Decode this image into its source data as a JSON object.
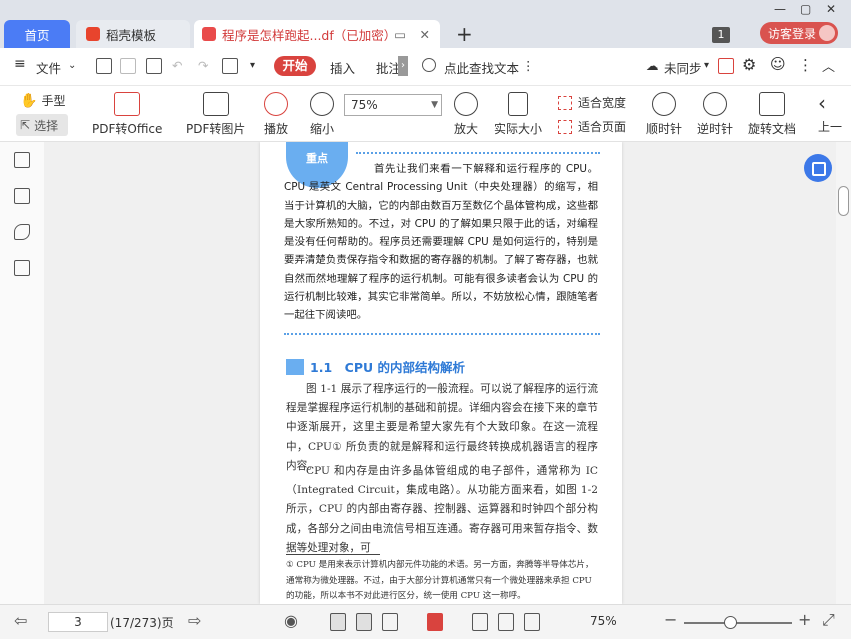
{
  "tabs": {
    "home": "首页",
    "daoke": "稻壳模板",
    "doc": "程序是怎样跑起...df（已加密）"
  },
  "window": {
    "badge": "1",
    "login": "访客登录"
  },
  "menu": {
    "file": "文件",
    "start": "开始",
    "insert": "插入",
    "annotate": "批注",
    "search_placeholder": "点此查找文本",
    "sync": "未同步"
  },
  "ribbon": {
    "hand": "手型",
    "select": "选择",
    "pdf_to_office": "PDF转Office",
    "pdf_to_image": "PDF转图片",
    "play": "播放",
    "zoom_out": "缩小",
    "zoom_value": "75%",
    "zoom_in": "放大",
    "actual_size": "实际大小",
    "fit_width": "适合宽度",
    "fit_page": "适合页面",
    "rotate_cw": "顺时针",
    "rotate_ccw": "逆时针",
    "rotate_doc": "旋转文档",
    "prev": "上一"
  },
  "document": {
    "keypoint": "重点",
    "intro": "首先让我们来看一下解释和运行程序的 CPU。CPU 是英文 Central Processing Unit（中央处理器）的缩写，相当于计算机的大脑，它的内部由数百万至数亿个晶体管构成，这些都是大家所熟知的。不过，对 CPU 的了解如果只限于此的话，对编程是没有任何帮助的。程序员还需要理解 CPU 是如何运行的，特别是要弄清楚负责保存指令和数据的寄存器的机制。了解了寄存器，也就自然而然地理解了程序的运行机制。可能有很多读者会认为 CPU 的运行机制比较难，其实它非常简单。所以，不妨放松心情，跟随笔者一起往下阅读吧。",
    "section_title": "1.1　CPU 的内部结构解析",
    "para1": "图 1-1 展示了程序运行的一般流程。可以说了解程序的运行流程是掌握程序运行机制的基础和前提。详细内容会在接下来的章节中逐渐展开，这里主要是希望大家先有个大致印象。在这一流程中，CPU① 所负责的就是解释和运行最终转换成机器语言的程序内容。",
    "para2": "CPU 和内存是由许多晶体管组成的电子部件，通常称为 IC（Integrated Circuit，集成电路）。从功能方面来看，如图 1-2 所示，CPU 的内部由寄存器、控制器、运算器和时钟四个部分构成，各部分之间由电流信号相互连通。寄存器可用来暂存指令、数据等处理对象，可",
    "footnote": "① CPU 是用来表示计算机内部元件功能的术语。另一方面，奔腾等半导体芯片，通常称为微处理器。不过，由于大部分计算机通常只有一个微处理器来承担 CPU 的功能，所以本书不对此进行区分，统一使用 CPU 这一称呼。"
  },
  "status": {
    "page": "3",
    "count": "(17/273)页",
    "zoom": "75%"
  },
  "colors": {
    "accent": "#4b7cf5",
    "brand_red": "#d9433e",
    "doc_blue": "#2f7ad6"
  }
}
